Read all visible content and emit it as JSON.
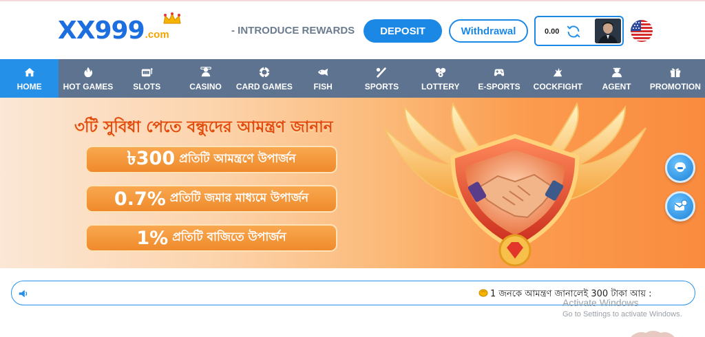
{
  "header": {
    "logo_text": "XX999",
    "logo_suffix": ".com",
    "introduce_label": "- INTRODUCE REWARDS",
    "deposit_label": "DEPOSIT",
    "withdraw_label": "Withdrawal",
    "balance": "0.00",
    "icons": {
      "refresh": "refresh-icon",
      "avatar": "avatar",
      "flag": "us-flag-icon"
    }
  },
  "nav": {
    "items": [
      {
        "label": "HOME",
        "icon": "home-icon",
        "active": true
      },
      {
        "label": "HOT GAMES",
        "icon": "flame-icon"
      },
      {
        "label": "SLOTS",
        "icon": "slot-machine-icon"
      },
      {
        "label": "CASINO",
        "icon": "casino-dealer-icon"
      },
      {
        "label": "CARD GAMES",
        "icon": "poker-chip-icon"
      },
      {
        "label": "FISH",
        "icon": "fish-icon"
      },
      {
        "label": "SPORTS",
        "icon": "sports-icon"
      },
      {
        "label": "LOTTERY",
        "icon": "lottery-balls-icon"
      },
      {
        "label": "E-SPORTS",
        "icon": "gamepad-icon"
      },
      {
        "label": "COCKFIGHT",
        "icon": "cockfight-icon"
      },
      {
        "label": "AGENT",
        "icon": "agent-icon"
      },
      {
        "label": "PROMOTION",
        "icon": "gift-icon"
      }
    ],
    "colors": {
      "bar": "#5d7390",
      "active": "#2490e8"
    }
  },
  "banner": {
    "title": "৩টি সুবিধা পেতে বন্ধুদের আমন্ত্রণ জানান",
    "rows": [
      {
        "big": "৳300",
        "small": "প্রতিটি আমন্ত্রণে উপার্জন"
      },
      {
        "big": "0.7%",
        "small": "প্রতিটি জমার মাধ্যমে উপার্জন"
      },
      {
        "big": "1%",
        "small": "প্রতিটি বাজিতে উপার্জন"
      }
    ],
    "emblem_icon": "handshake-emblem"
  },
  "floating": [
    {
      "icon": "support-headset-icon"
    },
    {
      "icon": "message-icon"
    }
  ],
  "marquee": {
    "icon": "speaker-icon",
    "text": "1 জনকে আমন্ত্রণ জানালেই 300 টাকা আয় :"
  },
  "watermark": {
    "line1": "Activate Windows",
    "line2": "Go to Settings to activate Windows."
  }
}
